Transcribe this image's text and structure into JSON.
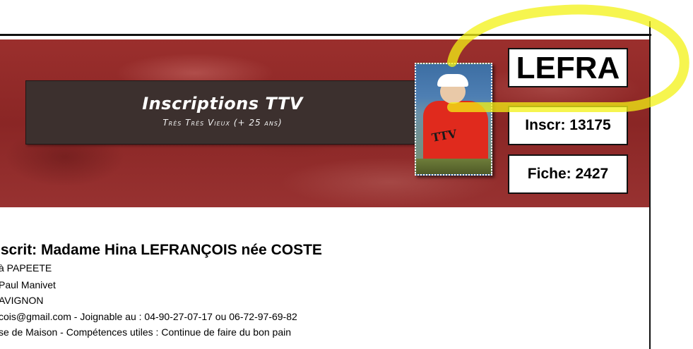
{
  "header": {
    "title": "Inscriptions TTV",
    "subtitle": "Très Très Vieux (+ 25 ans)",
    "photo_text": "TTV"
  },
  "side_boxes": {
    "code": "LEFRA",
    "inscription": "Inscr: 13175",
    "fiche": "Fiche: 2427"
  },
  "highlight": {
    "color": "#f3f214"
  },
  "person": {
    "heading": "nscrit: Madame Hina LEFRANÇOIS née COSTE",
    "lines": [
      "à PAPEETE",
      "Paul Manivet",
      "AVIGNON",
      "cois@gmail.com - Joignable au  : 04-90-27-07-17 ou 06-72-97-69-82",
      "se de Maison - Compétences utiles : Continue de faire du bon pain"
    ]
  },
  "colors": {
    "banner": "#8f2a28",
    "title_box": "#3c302e"
  }
}
